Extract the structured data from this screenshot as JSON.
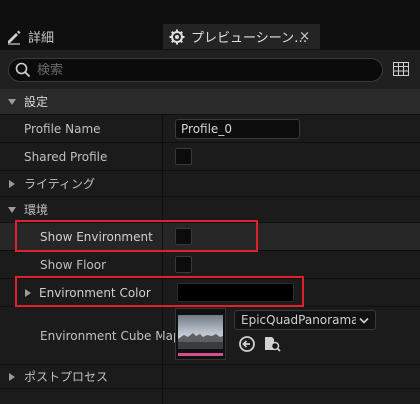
{
  "tabs": [
    {
      "label": "詳細",
      "icon": "pencil-icon"
    },
    {
      "label": "プレビューシーン…",
      "icon": "gear-icon",
      "close": "×"
    }
  ],
  "search": {
    "placeholder": "検索"
  },
  "sections": {
    "settings": "設定",
    "lighting": "ライティング",
    "environment": "環境",
    "postprocess": "ポストプロセス"
  },
  "properties": {
    "profile_name": {
      "label": "Profile Name",
      "value": "Profile_0"
    },
    "shared_profile": {
      "label": "Shared Profile",
      "checked": false
    },
    "show_environment": {
      "label": "Show Environment",
      "checked": false
    },
    "show_floor": {
      "label": "Show Floor",
      "checked": false
    },
    "environment_color": {
      "label": "Environment Color",
      "color": "#000000"
    },
    "environment_cube_map": {
      "label": "Environment Cube Map",
      "asset": "EpicQuadPanorama_C"
    }
  },
  "colors": {
    "highlight": "#e0202a",
    "thumb_accent": "#d4508a"
  }
}
